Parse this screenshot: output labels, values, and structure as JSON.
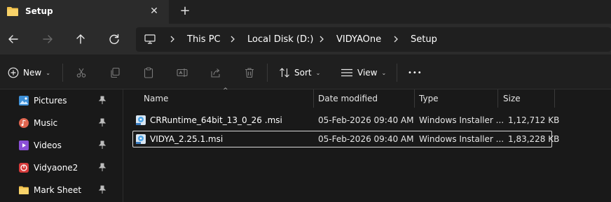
{
  "tab": {
    "title": "Setup",
    "close_glyph": "✕",
    "add_glyph": "+",
    "folder_icon": "folder-icon"
  },
  "nav": {
    "back_icon": "arrow-left-icon",
    "forward_icon": "arrow-right-icon",
    "up_icon": "arrow-up-icon",
    "refresh_icon": "refresh-icon"
  },
  "address": {
    "root_icon": "this-pc-icon",
    "crumbs": [
      "This PC",
      "Local Disk (D:)",
      "VIDYAOne",
      "Setup"
    ]
  },
  "toolbar": {
    "new_label": "New",
    "sort_label": "Sort",
    "view_label": "View",
    "more_glyph": "•••",
    "icons": [
      "new-icon",
      "cut-icon",
      "copy-icon",
      "paste-icon",
      "rename-icon",
      "share-icon",
      "delete-icon",
      "sort-icon",
      "view-icon",
      "more-icon"
    ]
  },
  "sidebar": {
    "items": [
      {
        "label": "Pictures",
        "icon": "pictures-icon",
        "pinned": true
      },
      {
        "label": "Music",
        "icon": "music-icon",
        "pinned": true
      },
      {
        "label": "Videos",
        "icon": "videos-icon",
        "pinned": true
      },
      {
        "label": "Vidyaone2",
        "icon": "app-icon",
        "pinned": true
      },
      {
        "label": "Mark Sheet",
        "icon": "folder-icon",
        "pinned": true
      }
    ]
  },
  "files": {
    "columns": [
      "Name",
      "Date modified",
      "Type",
      "Size"
    ],
    "sorted_by": "Name",
    "rows": [
      {
        "name": "CRRuntime_64bit_13_0_26 .msi",
        "date": "05-Feb-2026 09:40 AM",
        "type": "Windows Installer ...",
        "size": "1,12,712 KB",
        "selected": false
      },
      {
        "name": "VIDYA_2.25.1.msi",
        "date": "05-Feb-2026 09:40 AM",
        "type": "Windows Installer ...",
        "size": "1,83,228 KB",
        "selected": true
      }
    ]
  },
  "colors": {
    "background": "#191919",
    "chrome": "#2b2b2b",
    "folder": "#f2c14b",
    "accent": "#4ea6e8"
  }
}
